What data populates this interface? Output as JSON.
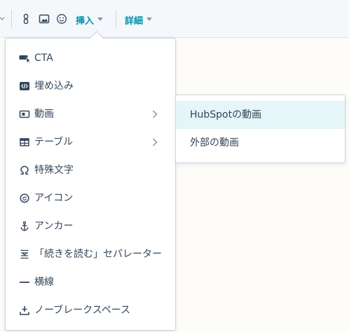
{
  "toolbar": {
    "icons": [
      "chevron-down-icon",
      "link-icon",
      "image-icon",
      "emoji-icon"
    ],
    "insert_label": "挿入",
    "details_label": "詳細"
  },
  "insert_menu": {
    "items": [
      {
        "label": "CTA",
        "icon": "cta-icon",
        "submenu": false
      },
      {
        "label": "埋め込み",
        "icon": "embed-icon",
        "submenu": false
      },
      {
        "label": "動画",
        "icon": "video-icon",
        "submenu": true
      },
      {
        "label": "テーブル",
        "icon": "table-icon",
        "submenu": true
      },
      {
        "label": "特殊文字",
        "icon": "omega-icon",
        "submenu": false
      },
      {
        "label": "アイコン",
        "icon": "icon-picker-icon",
        "submenu": false
      },
      {
        "label": "アンカー",
        "icon": "anchor-icon",
        "submenu": false
      },
      {
        "label": "「続きを読む」セパレーター",
        "icon": "read-more-separator-icon",
        "submenu": false
      },
      {
        "label": "横線",
        "icon": "horizontal-rule-icon",
        "submenu": false
      },
      {
        "label": "ノーブレークスペース",
        "icon": "non-breaking-space-icon",
        "submenu": false
      }
    ]
  },
  "video_submenu": {
    "items": [
      {
        "label": "HubSpotの動画",
        "active": true
      },
      {
        "label": "外部の動画",
        "active": false
      }
    ]
  },
  "colors": {
    "accent": "#0091ae",
    "text": "#33475b",
    "border": "#cbd6e2",
    "toolbar_bg": "#f5f8fa",
    "hover_bg": "#e5f5f8"
  }
}
